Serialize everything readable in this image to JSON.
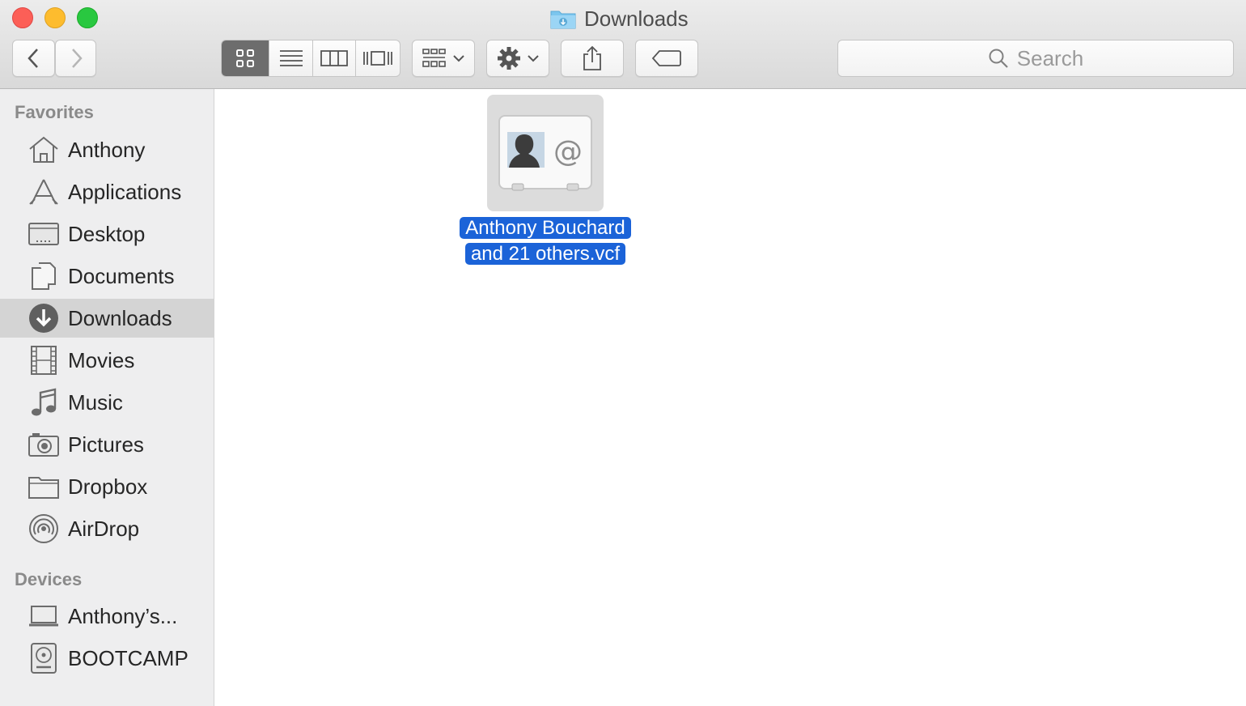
{
  "window": {
    "title": "Downloads"
  },
  "toolbar": {
    "search_placeholder": "Search",
    "view_modes": [
      "icon-view",
      "list-view",
      "column-view",
      "cover-flow-view"
    ],
    "active_view": "icon-view"
  },
  "sidebar": {
    "favorites_title": "Favorites",
    "favorites": [
      {
        "label": "Anthony",
        "icon": "home-icon"
      },
      {
        "label": "Applications",
        "icon": "applications-icon"
      },
      {
        "label": "Desktop",
        "icon": "desktop-icon"
      },
      {
        "label": "Documents",
        "icon": "documents-icon"
      },
      {
        "label": "Downloads",
        "icon": "downloads-icon",
        "selected": true
      },
      {
        "label": "Movies",
        "icon": "movies-icon"
      },
      {
        "label": "Music",
        "icon": "music-icon"
      },
      {
        "label": "Pictures",
        "icon": "pictures-icon"
      },
      {
        "label": "Dropbox",
        "icon": "folder-icon"
      },
      {
        "label": "AirDrop",
        "icon": "airdrop-icon"
      }
    ],
    "devices_title": "Devices",
    "devices": [
      {
        "label": "Anthony’s...",
        "icon": "laptop-icon"
      },
      {
        "label": "BOOTCAMP",
        "icon": "disk-icon"
      }
    ]
  },
  "files": [
    {
      "name_line1": "Anthony Bouchard",
      "name_line2": "and 21 others.vcf",
      "icon": "vcard-icon",
      "selected": true
    }
  ],
  "colors": {
    "selection": "#1b63d8",
    "sidebar_selected": "#d4d4d4"
  }
}
